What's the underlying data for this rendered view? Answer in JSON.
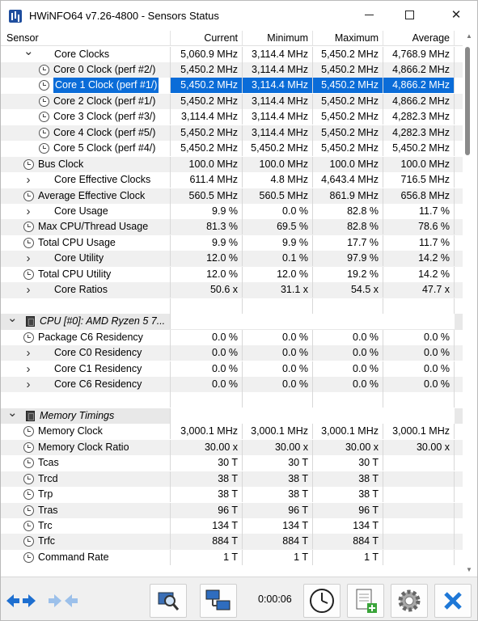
{
  "window": {
    "title": "HWiNFO64 v7.26-4800 - Sensors Status"
  },
  "columns": [
    "Sensor",
    "Current",
    "Minimum",
    "Maximum",
    "Average"
  ],
  "rows": [
    {
      "indent": 1,
      "expander": "v",
      "icon": "none",
      "label": "Core Clocks",
      "cur": "5,060.9 MHz",
      "min": "3,114.4 MHz",
      "max": "5,450.2 MHz",
      "avg": "4,768.9 MHz"
    },
    {
      "indent": 2,
      "expander": "",
      "icon": "clock",
      "label": "Core 0 Clock (perf #2/)",
      "cur": "5,450.2 MHz",
      "min": "3,114.4 MHz",
      "max": "5,450.2 MHz",
      "avg": "4,866.2 MHz"
    },
    {
      "indent": 2,
      "expander": "",
      "icon": "clock",
      "label": "Core 1 Clock (perf #1/)",
      "cur": "5,450.2 MHz",
      "min": "3,114.4 MHz",
      "max": "5,450.2 MHz",
      "avg": "4,866.2 MHz",
      "selected": true
    },
    {
      "indent": 2,
      "expander": "",
      "icon": "clock",
      "label": "Core 2 Clock (perf #1/)",
      "cur": "5,450.2 MHz",
      "min": "3,114.4 MHz",
      "max": "5,450.2 MHz",
      "avg": "4,866.2 MHz"
    },
    {
      "indent": 2,
      "expander": "",
      "icon": "clock",
      "label": "Core 3 Clock (perf #3/)",
      "cur": "3,114.4 MHz",
      "min": "3,114.4 MHz",
      "max": "5,450.2 MHz",
      "avg": "4,282.3 MHz"
    },
    {
      "indent": 2,
      "expander": "",
      "icon": "clock",
      "label": "Core 4 Clock (perf #5/)",
      "cur": "5,450.2 MHz",
      "min": "3,114.4 MHz",
      "max": "5,450.2 MHz",
      "avg": "4,282.3 MHz"
    },
    {
      "indent": 2,
      "expander": "",
      "icon": "clock",
      "label": "Core 5 Clock (perf #4/)",
      "cur": "5,450.2 MHz",
      "min": "5,450.2 MHz",
      "max": "5,450.2 MHz",
      "avg": "5,450.2 MHz"
    },
    {
      "indent": 1,
      "expander": "",
      "icon": "clock",
      "label": "Bus Clock",
      "cur": "100.0 MHz",
      "min": "100.0 MHz",
      "max": "100.0 MHz",
      "avg": "100.0 MHz"
    },
    {
      "indent": 1,
      "expander": ">",
      "icon": "none",
      "label": "Core Effective Clocks",
      "cur": "611.4 MHz",
      "min": "4.8 MHz",
      "max": "4,643.4 MHz",
      "avg": "716.5 MHz"
    },
    {
      "indent": 1,
      "expander": "",
      "icon": "clock",
      "label": "Average Effective Clock",
      "cur": "560.5 MHz",
      "min": "560.5 MHz",
      "max": "861.9 MHz",
      "avg": "656.8 MHz"
    },
    {
      "indent": 1,
      "expander": ">",
      "icon": "none",
      "label": "Core Usage",
      "cur": "9.9 %",
      "min": "0.0 %",
      "max": "82.8 %",
      "avg": "11.7 %"
    },
    {
      "indent": 1,
      "expander": "",
      "icon": "clock",
      "label": "Max CPU/Thread Usage",
      "cur": "81.3 %",
      "min": "69.5 %",
      "max": "82.8 %",
      "avg": "78.6 %"
    },
    {
      "indent": 1,
      "expander": "",
      "icon": "clock",
      "label": "Total CPU Usage",
      "cur": "9.9 %",
      "min": "9.9 %",
      "max": "17.7 %",
      "avg": "11.7 %"
    },
    {
      "indent": 1,
      "expander": ">",
      "icon": "none",
      "label": "Core Utility",
      "cur": "12.0 %",
      "min": "0.1 %",
      "max": "97.9 %",
      "avg": "14.2 %"
    },
    {
      "indent": 1,
      "expander": "",
      "icon": "clock",
      "label": "Total CPU Utility",
      "cur": "12.0 %",
      "min": "12.0 %",
      "max": "19.2 %",
      "avg": "14.2 %"
    },
    {
      "indent": 1,
      "expander": ">",
      "icon": "none",
      "label": "Core Ratios",
      "cur": "50.6 x",
      "min": "31.1 x",
      "max": "54.5 x",
      "avg": "47.7 x"
    },
    {
      "indent": 0,
      "expander": "",
      "icon": "none",
      "label": "",
      "cur": "",
      "min": "",
      "max": "",
      "avg": ""
    },
    {
      "indent": 0,
      "expander": "v",
      "icon": "chip",
      "label": "CPU [#0]: AMD Ryzen 5 7...",
      "cur": "",
      "min": "",
      "max": "",
      "avg": "",
      "group": true
    },
    {
      "indent": 1,
      "expander": "",
      "icon": "clock",
      "label": "Package C6 Residency",
      "cur": "0.0 %",
      "min": "0.0 %",
      "max": "0.0 %",
      "avg": "0.0 %"
    },
    {
      "indent": 1,
      "expander": ">",
      "icon": "none",
      "label": "Core C0 Residency",
      "cur": "0.0 %",
      "min": "0.0 %",
      "max": "0.0 %",
      "avg": "0.0 %"
    },
    {
      "indent": 1,
      "expander": ">",
      "icon": "none",
      "label": "Core C1 Residency",
      "cur": "0.0 %",
      "min": "0.0 %",
      "max": "0.0 %",
      "avg": "0.0 %"
    },
    {
      "indent": 1,
      "expander": ">",
      "icon": "none",
      "label": "Core C6 Residency",
      "cur": "0.0 %",
      "min": "0.0 %",
      "max": "0.0 %",
      "avg": "0.0 %"
    },
    {
      "indent": 0,
      "expander": "",
      "icon": "none",
      "label": "",
      "cur": "",
      "min": "",
      "max": "",
      "avg": ""
    },
    {
      "indent": 0,
      "expander": "v",
      "icon": "chip",
      "label": "Memory Timings",
      "cur": "",
      "min": "",
      "max": "",
      "avg": "",
      "group": true
    },
    {
      "indent": 1,
      "expander": "",
      "icon": "clock",
      "label": "Memory Clock",
      "cur": "3,000.1 MHz",
      "min": "3,000.1 MHz",
      "max": "3,000.1 MHz",
      "avg": "3,000.1 MHz"
    },
    {
      "indent": 1,
      "expander": "",
      "icon": "clock",
      "label": "Memory Clock Ratio",
      "cur": "30.00 x",
      "min": "30.00 x",
      "max": "30.00 x",
      "avg": "30.00 x"
    },
    {
      "indent": 1,
      "expander": "",
      "icon": "clock",
      "label": "Tcas",
      "cur": "30 T",
      "min": "30 T",
      "max": "30 T",
      "avg": ""
    },
    {
      "indent": 1,
      "expander": "",
      "icon": "clock",
      "label": "Trcd",
      "cur": "38 T",
      "min": "38 T",
      "max": "38 T",
      "avg": ""
    },
    {
      "indent": 1,
      "expander": "",
      "icon": "clock",
      "label": "Trp",
      "cur": "38 T",
      "min": "38 T",
      "max": "38 T",
      "avg": ""
    },
    {
      "indent": 1,
      "expander": "",
      "icon": "clock",
      "label": "Tras",
      "cur": "96 T",
      "min": "96 T",
      "max": "96 T",
      "avg": ""
    },
    {
      "indent": 1,
      "expander": "",
      "icon": "clock",
      "label": "Trc",
      "cur": "134 T",
      "min": "134 T",
      "max": "134 T",
      "avg": ""
    },
    {
      "indent": 1,
      "expander": "",
      "icon": "clock",
      "label": "Trfc",
      "cur": "884 T",
      "min": "884 T",
      "max": "884 T",
      "avg": ""
    },
    {
      "indent": 1,
      "expander": "",
      "icon": "clock",
      "label": "Command Rate",
      "cur": "1 T",
      "min": "1 T",
      "max": "1 T",
      "avg": ""
    }
  ],
  "toolbar": {
    "timer": "0:00:06"
  },
  "colors": {
    "selection": "#0a6cd8",
    "close_icon": "#1e78d7",
    "row_alt": "#f0f0f0"
  }
}
